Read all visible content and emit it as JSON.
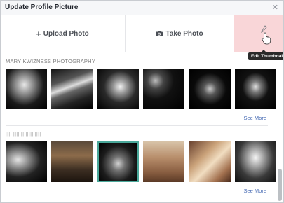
{
  "dialog": {
    "title": "Update Profile Picture",
    "close_icon": "close-icon"
  },
  "actions": {
    "upload_label": "Upload Photo",
    "take_label": "Take Photo",
    "edit_tooltip": "Edit Thumbnail"
  },
  "albums": [
    {
      "title": "MARY KWIZNESS PHOTOGRAPHY",
      "see_more": "See More",
      "photos": [
        {
          "theme": "portrait-bw-man"
        },
        {
          "theme": "dj-turntable-bw"
        },
        {
          "theme": "dj-performer-bw"
        },
        {
          "theme": "stage-crowd-bw"
        },
        {
          "theme": "dancer-bw"
        },
        {
          "theme": "dj-spotlight-bw"
        }
      ]
    },
    {
      "title": "|||| ||||||| ||||||||||",
      "see_more": "See More",
      "photos": [
        {
          "theme": "woman-lying-bw"
        },
        {
          "theme": "couple-clock-color"
        },
        {
          "theme": "woman-dark-hair-bw"
        },
        {
          "theme": "children-faces-color"
        },
        {
          "theme": "woman-framed-warm"
        },
        {
          "theme": "woman-portrait-bw"
        }
      ]
    }
  ],
  "colors": {
    "link": "#4267b2",
    "edit_highlight": "#f9d6d8",
    "tooltip_bg": "#2a2a2a"
  }
}
